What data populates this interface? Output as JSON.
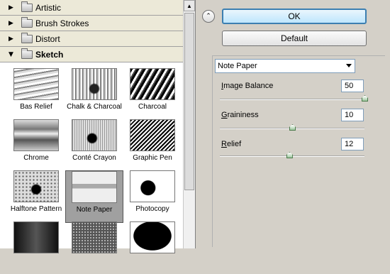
{
  "gallery": {
    "categories": [
      {
        "label": "Artistic",
        "expanded": false
      },
      {
        "label": "Brush Strokes",
        "expanded": false
      },
      {
        "label": "Distort",
        "expanded": false
      },
      {
        "label": "Sketch",
        "expanded": true
      }
    ],
    "filters": [
      {
        "label": "Bas Relief",
        "selected": false
      },
      {
        "label": "Chalk & Charcoal",
        "selected": false
      },
      {
        "label": "Charcoal",
        "selected": false
      },
      {
        "label": "Chrome",
        "selected": false
      },
      {
        "label": "Conté Crayon",
        "selected": false
      },
      {
        "label": "Graphic Pen",
        "selected": false
      },
      {
        "label": "Halftone Pattern",
        "selected": false
      },
      {
        "label": "Note Paper",
        "selected": true
      },
      {
        "label": "Photocopy",
        "selected": false
      }
    ]
  },
  "buttons": {
    "ok_label": "OK",
    "default_label": "Default"
  },
  "settings": {
    "filter_select": "Note Paper",
    "params": [
      {
        "label": "Image Balance",
        "value": "50",
        "slider_fraction": 1.0
      },
      {
        "label": "Graininess",
        "value": "10",
        "slider_fraction": 0.5
      },
      {
        "label": "Relief",
        "value": "12",
        "slider_fraction": 0.48
      }
    ]
  },
  "icons": {
    "expand": "triangle-right-icon",
    "collapse": "triangle-down-icon",
    "folder": "folder-icon",
    "collapse_panel": "double-chevron-up-icon"
  }
}
